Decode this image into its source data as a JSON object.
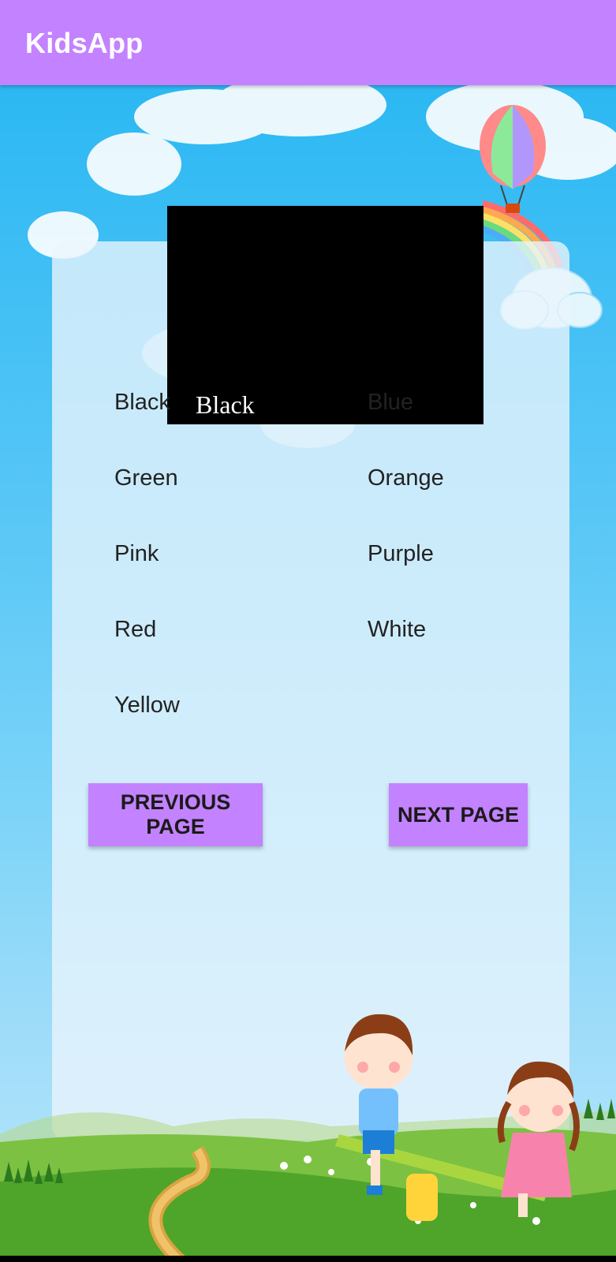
{
  "app": {
    "title": "KidsApp"
  },
  "colors": {
    "appbar": "#c382ff",
    "button": "#c382ff",
    "card_background": "#000000"
  },
  "card": {
    "label": "Black"
  },
  "color_words": [
    "Black",
    "Blue",
    "Green",
    "Orange",
    "Pink",
    "Purple",
    "Red",
    "White",
    "Yellow"
  ],
  "buttons": {
    "previous": "PREVIOUS PAGE",
    "next": "NEXT PAGE"
  },
  "icons": [
    "hot-air-balloon-illustration",
    "rainbow-illustration",
    "kids-seesaw-illustration"
  ]
}
